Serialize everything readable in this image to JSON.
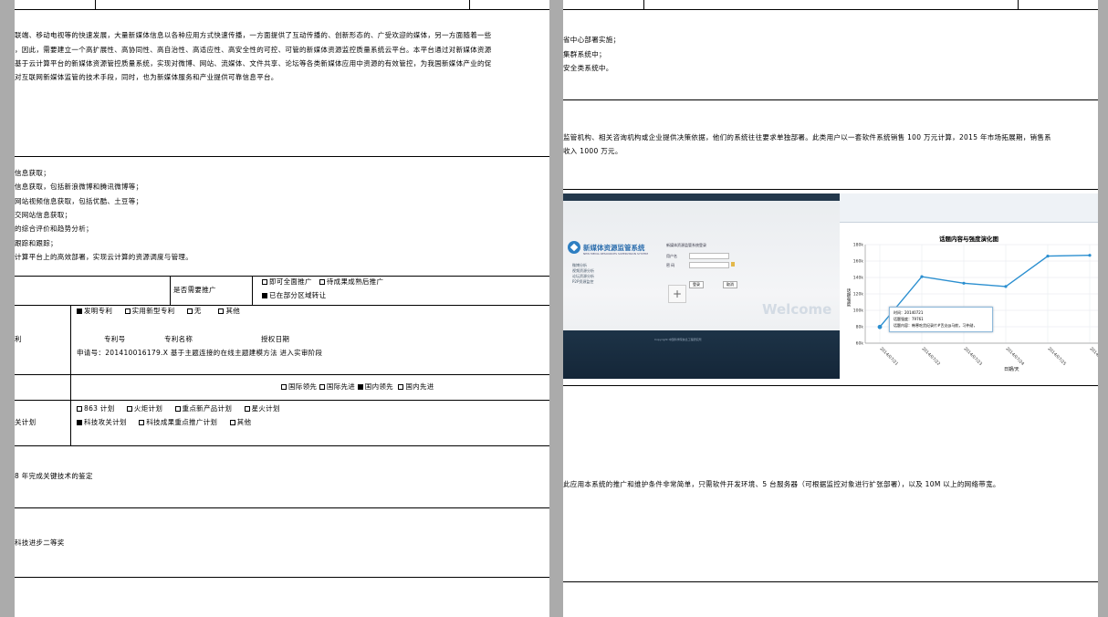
{
  "left_page": {
    "intro_lines": [
      "联端、移动电视等的快速发展，大量新媒体信息以各种应用方式快速传播，一方面提供了互动传播的、创新形态的、广受欢迎的媒体，另一方面随着一些",
      "，因此，需要建立一个高扩展性、高协同性、高自治性、高适应性、高安全性的可控、可管的新媒体资源监控质量系统云平台。本平台通过对新媒体资源",
      "基于云计算平台的新媒体资源管控质量系统，实现对微博、网站、流媒体、文件共享、论坛等各类新媒体应用中资源的有效管控，为我国新媒体产业的促",
      "对互联网新媒体监管的技术手段，同时，也为新媒体服务和产业提供可靠信息平台。"
    ],
    "func_lines": [
      "信息获取；",
      "信息获取，包括新浪微博和腾讯微博等；",
      "网站视频信息获取，包括优酷、土豆等；",
      "交网站信息获取；",
      "的综合评价和趋势分析；",
      "跟踪和跟踪；",
      "计算平台上的高效部署，实现云计算的资源调度与管理。"
    ],
    "promo_label": "是否需要推广",
    "promo_options": [
      {
        "label": "即可全面推广",
        "checked": false
      },
      {
        "label": "待成果成熟后推广",
        "checked": false
      },
      {
        "label": "已在部分区域转让",
        "checked": true
      }
    ],
    "patent_row_label": "利",
    "patent_types": [
      {
        "label": "发明专利",
        "checked": true
      },
      {
        "label": "实用新型专利",
        "checked": false
      },
      {
        "label": "无",
        "checked": false
      },
      {
        "label": "其他",
        "checked": false
      }
    ],
    "patent_headers": [
      "专利号",
      "专利名称",
      "授权日期"
    ],
    "patent_line": "申请号：201410016179.X 基于主题连接的在线主题建模方法 进入实审阶段",
    "level_options": [
      {
        "label": "国际领先",
        "checked": false
      },
      {
        "label": "国际先进",
        "checked": false
      },
      {
        "label": "国内领先",
        "checked": true
      },
      {
        "label": "国内先进",
        "checked": false
      }
    ],
    "plan_row_label": "关计划",
    "plan_options_row1": [
      {
        "label": "863 计划",
        "checked": false
      },
      {
        "label": "火炬计划",
        "checked": false
      },
      {
        "label": "重点新产品计划",
        "checked": false
      },
      {
        "label": "星火计划",
        "checked": false
      }
    ],
    "plan_options_row2": [
      {
        "label": "科技攻关计划",
        "checked": true
      },
      {
        "label": "科技成果重点推广计划",
        "checked": false
      },
      {
        "label": "其他",
        "checked": false
      }
    ],
    "appraisal_text": "8 年完成关键技术的鉴定",
    "award_text": "科技进步二等奖"
  },
  "right_page": {
    "top_lines": [
      "省中心部署实施；",
      "集群系统中；",
      "安全类系统中。"
    ],
    "market_lines": [
      "监管机构、相关咨询机构或企业提供决策依据，他们的系统往往要求单独部署。此类用户以一套软件系统销售 100 万元计算，2015 年市场拓展期，销售系",
      "收入 1000 万元。"
    ],
    "login_screenshot": {
      "system_name": "新媒体资源监管系统",
      "system_subtitle": "NEW MEDIA RESOURCES SUPERVISION SYSTEM",
      "nav_items": [
        "微博分析",
        "视频资源分析",
        "论坛资源分析",
        "P2P资源监控"
      ],
      "login_title": "新媒体资源监管系统登录",
      "user_label": "用户名",
      "password_label": "密 码",
      "login_button": "登录",
      "cancel_button": "取消",
      "welcome": "Welcome",
      "footer": "Copyright 中国科学院信息工程研究所"
    },
    "chart_data": {
      "type": "line",
      "title": "话题内容与强度演化图",
      "ylabel": "话题强度",
      "xlabel": "日期/天",
      "categories": [
        "2014/07/21",
        "2014/07/22",
        "2014/07/23",
        "2014/07/24",
        "2014/07/25",
        "2014/07/26"
      ],
      "series": [
        {
          "values": [
            79761,
            141000,
            133000,
            129000,
            166000,
            167000
          ]
        }
      ],
      "y_ticks": [
        "60k",
        "80k",
        "100k",
        "120k",
        "140k",
        "160k",
        "180k"
      ],
      "ylim": [
        60000,
        180000
      ],
      "color": "#2b8fd0",
      "tooltip": {
        "date_line": "时间：20140721",
        "value_line": "话题强度：79761",
        "content_line": "话题内容：韩寒吃货纪录片#舌尖@马航，习仲勋，"
      }
    },
    "deploy_line": "此应用本系统的推广和维护条件非常简单，只需软件开发环境、5 台服务器（可根据监控对象进行扩张部署），以及 10M 以上的网络带宽。"
  }
}
